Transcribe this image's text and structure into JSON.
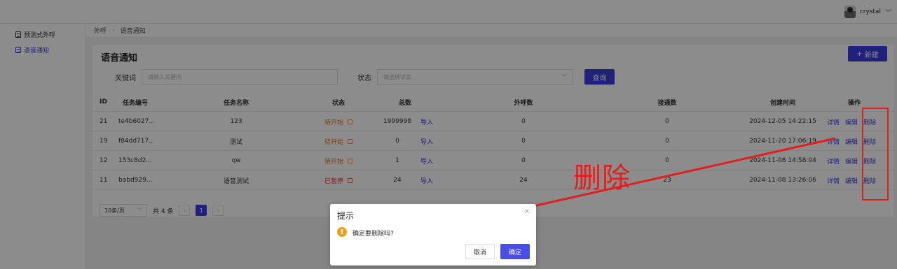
{
  "header": {
    "username": "crystal"
  },
  "sidebar": {
    "items": [
      {
        "label": "预测式外呼",
        "active": false
      },
      {
        "label": "语音通知",
        "active": true
      }
    ]
  },
  "breadcrumb": {
    "items": [
      "外呼",
      "语音通知"
    ]
  },
  "page": {
    "title": "语音通知",
    "new_button": "新建",
    "filters": {
      "keyword_label": "关键词",
      "keyword_placeholder": "请输入关键词",
      "status_label": "状态",
      "status_placeholder": "请选择状态",
      "search_button": "查询"
    }
  },
  "table": {
    "headers": [
      "ID",
      "任务编号",
      "任务名称",
      "状态",
      "总数",
      "外呼数",
      "接通数",
      "创建时间",
      "操作"
    ],
    "rows": [
      {
        "id": "21",
        "code": "te4b6027...",
        "name": "123",
        "status": "待开始",
        "total": "1999998",
        "import": "导入",
        "calls": "0",
        "connected": "0",
        "created": "2024-12-05 14:22:15"
      },
      {
        "id": "19",
        "code": "f84dd717...",
        "name": "测试",
        "status": "待开始",
        "total": "0",
        "import": "导入",
        "calls": "0",
        "connected": "0",
        "created": "2024-11-20 17:06:19"
      },
      {
        "id": "12",
        "code": "153c8d2...",
        "name": "qw",
        "status": "待开始",
        "total": "1",
        "import": "导入",
        "calls": "0",
        "connected": "0",
        "created": "2024-11-08 14:58:04"
      },
      {
        "id": "11",
        "code": "babd929...",
        "name": "语音测试",
        "status": "已暂停",
        "total": "24",
        "import": "导入",
        "calls": "24",
        "connected": "23",
        "created": "2024-11-08 13:26:06"
      }
    ],
    "ops": {
      "detail": "详情",
      "edit": "编辑",
      "delete": "删除"
    }
  },
  "pager": {
    "page_size": "10条/页",
    "total": "共 4 条",
    "current_page": "1"
  },
  "annotation": {
    "text": "删除",
    "color": "#e21f1f"
  },
  "dialog": {
    "title": "提示",
    "close": "×",
    "message": "确定要删除吗?",
    "cancel": "取消",
    "confirm": "确定"
  },
  "colors": {
    "accent": "#3a3de0",
    "pending": "#e6702a",
    "paused": "#d63a2c",
    "warning": "#f0a020"
  }
}
